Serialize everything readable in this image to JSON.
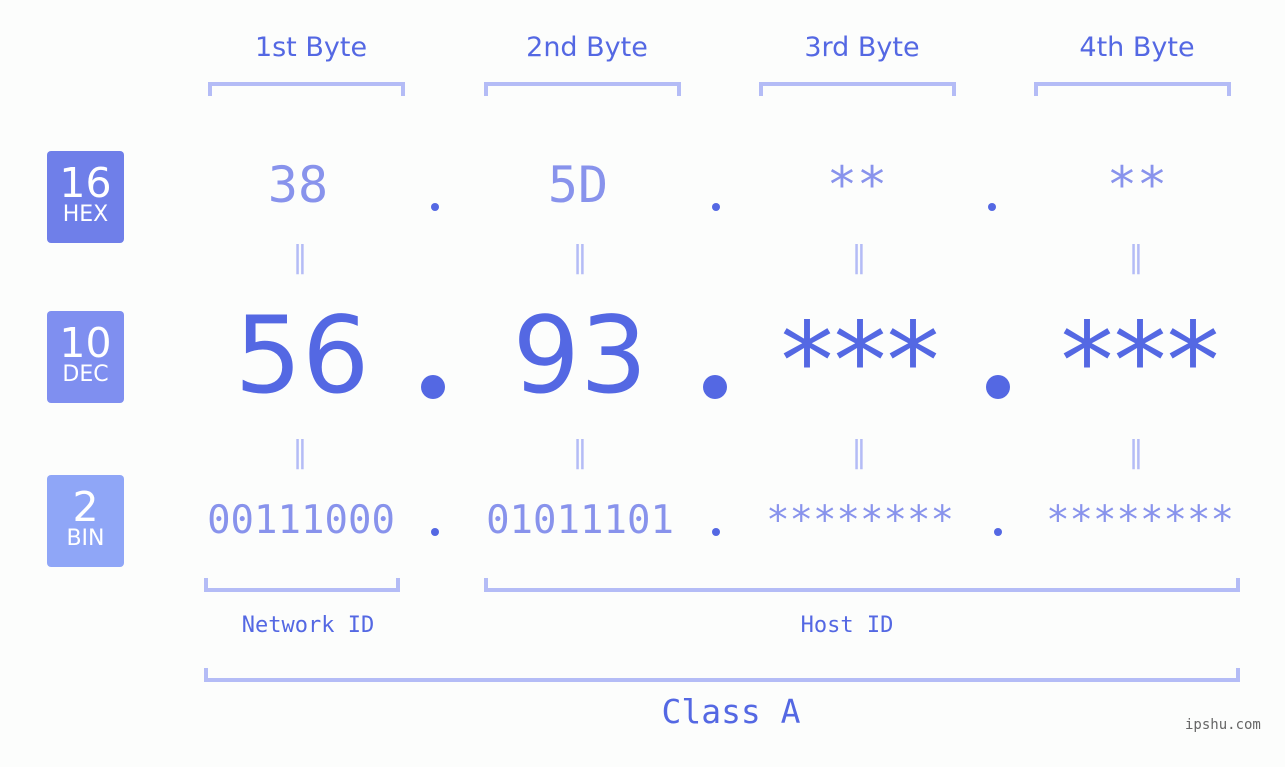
{
  "header": {
    "bytes": [
      "1st Byte",
      "2nd Byte",
      "3rd Byte",
      "4th Byte"
    ]
  },
  "badges": {
    "hex": {
      "num": "16",
      "label": "HEX",
      "color": "#6f7fe9"
    },
    "dec": {
      "num": "10",
      "label": "DEC",
      "color": "#7f8ff0"
    },
    "bin": {
      "num": "2",
      "label": "BIN",
      "color": "#8fa6f7"
    }
  },
  "rows": {
    "hex": [
      "38",
      "5D",
      "**",
      "**"
    ],
    "dec": [
      "56",
      "93",
      "***",
      "***"
    ],
    "bin": [
      "00111000",
      "01011101",
      "********",
      "********"
    ]
  },
  "separator": ".",
  "equals": "=",
  "labels": {
    "network_id": "Network ID",
    "host_id": "Host ID",
    "class": "Class A"
  },
  "watermark": "ipshu.com",
  "colors": {
    "accent": "#5468e3",
    "light": "#8893ec",
    "bracket": "#b4bcf6"
  }
}
